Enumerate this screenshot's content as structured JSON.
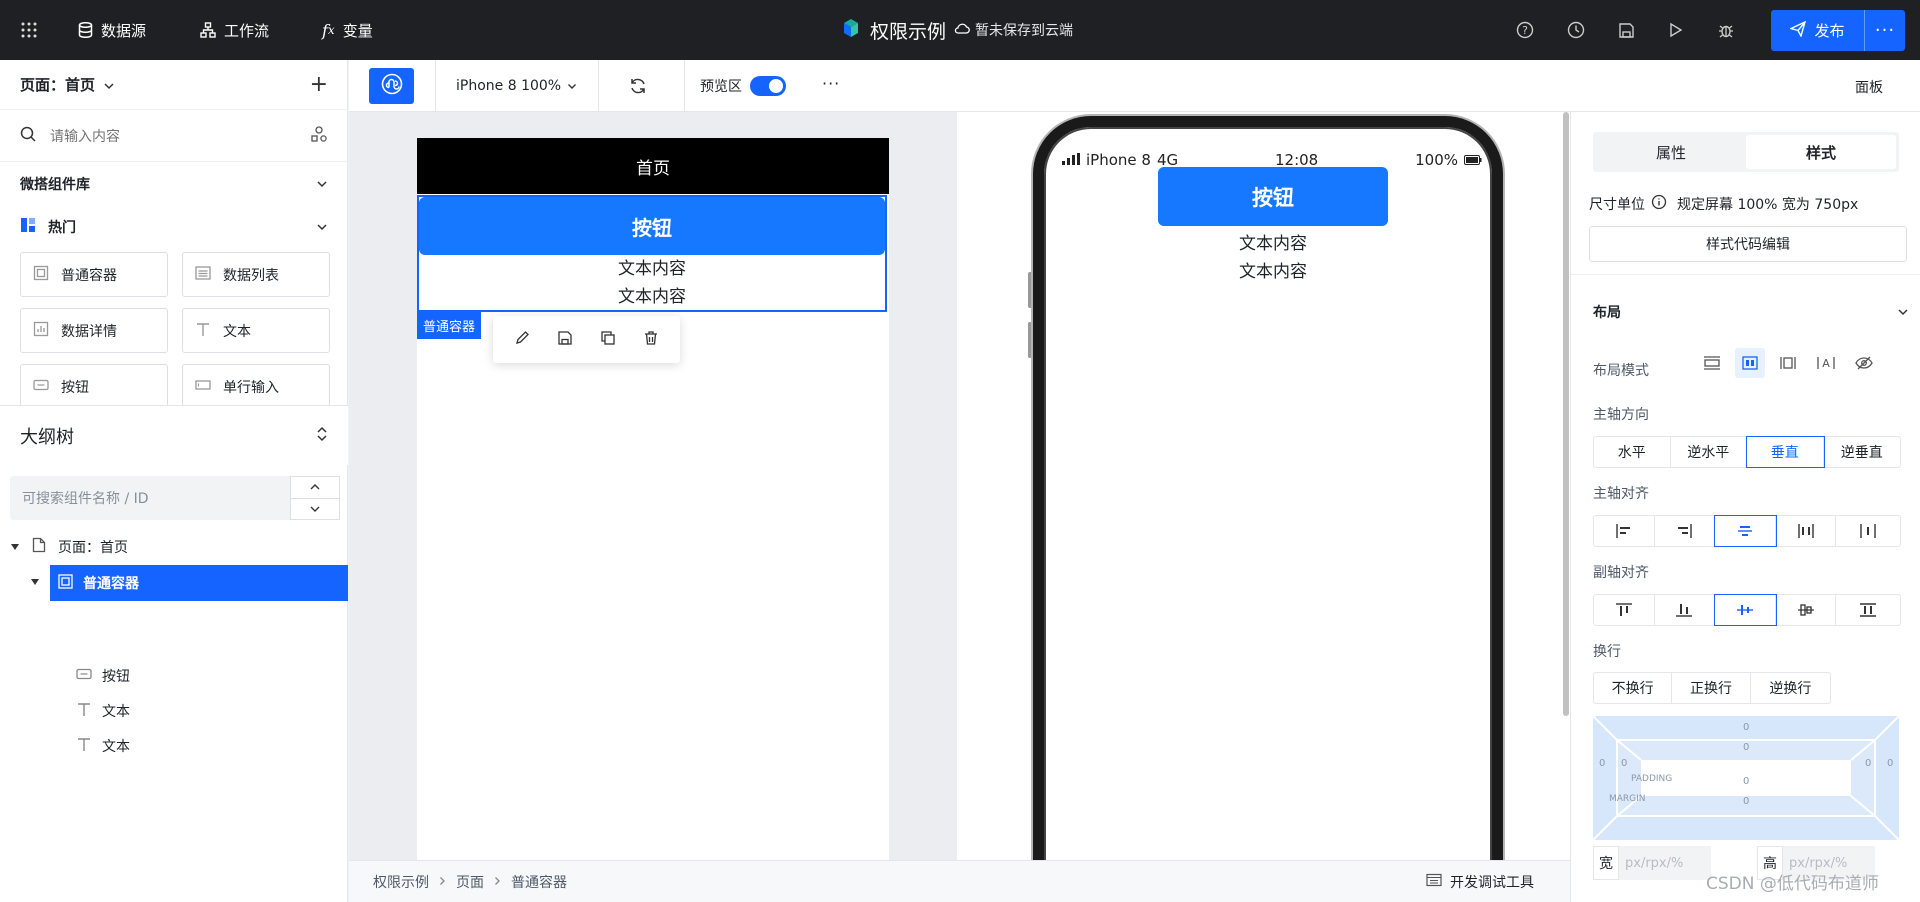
{
  "topbar": {
    "menu_datasource": "数据源",
    "menu_workflow": "工作流",
    "menu_variable": "变量",
    "app_title": "权限示例",
    "save_status": "暂未保存到云端",
    "publish_label": "发布",
    "more_label": "···"
  },
  "left_panel": {
    "page_title": "页面：首页",
    "search_placeholder": "请输入内容",
    "library_title": "微搭组件库",
    "hot_title": "热门",
    "components": [
      "普通容器",
      "数据列表",
      "数据详情",
      "文本",
      "按钮",
      "单行输入"
    ],
    "outline_title": "大纲树",
    "outline_search_placeholder": "可搜索组件名称 / ID",
    "tree": [
      {
        "label": "页面：首页"
      },
      {
        "label": "普通容器"
      },
      {
        "label": "按钮"
      },
      {
        "label": "文本"
      },
      {
        "label": "文本"
      }
    ]
  },
  "toolbar": {
    "device": "iPhone 8 100%",
    "preview_label": "预览区",
    "more": "···",
    "panel_label": "面板"
  },
  "canvas": {
    "page_header": "首页",
    "button_label": "按钮",
    "text1": "文本内容",
    "text2": "文本内容",
    "container_label": "普通容器"
  },
  "preview": {
    "carrier": "iPhone 8",
    "network": "4G",
    "time": "12:08",
    "battery": "100%",
    "button_label": "按钮",
    "text1": "文本内容",
    "text2": "文本内容"
  },
  "breadcrumb": {
    "items": [
      "权限示例",
      "页面",
      "普通容器"
    ],
    "devtools": "开发调试工具"
  },
  "right_panel": {
    "tab_props": "属性",
    "tab_style": "样式",
    "size_unit_label": "尺寸单位",
    "size_unit_value": "规定屏幕 100% 宽为 750px",
    "style_code_button": "样式代码编辑",
    "layout_title": "布局",
    "layout_mode_label": "布局模式",
    "main_axis_label": "主轴方向",
    "main_axis_options": [
      "水平",
      "逆水平",
      "垂直",
      "逆垂直"
    ],
    "main_align_label": "主轴对齐",
    "cross_align_label": "副轴对齐",
    "wrap_label": "换行",
    "wrap_options": [
      "不换行",
      "正换行",
      "逆换行"
    ],
    "box_values": [
      "0",
      "0",
      "0",
      "0",
      "0",
      "0",
      "0",
      "0"
    ],
    "padding_label": "PADDING",
    "margin_label": "MARGIN",
    "width_label": "宽",
    "height_label": "高",
    "size_placeholder": "px/rpx/%"
  },
  "watermark": "CSDN @低代码布道师",
  "colors": {
    "accent": "#1664ff",
    "topbar": "#1f2023",
    "component_blue": "#1677ff"
  }
}
